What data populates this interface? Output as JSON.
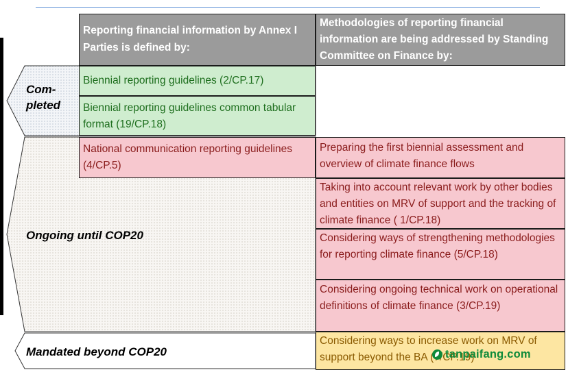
{
  "headers": {
    "left": "Reporting financial information by Annex I Parties is defined by:",
    "right": "Methodologies of reporting financial information are being addressed by  Standing Committee on Finance  by:"
  },
  "bands": {
    "completed_line1": "Com-",
    "completed_line2": "pleted",
    "ongoing": "Ongoing until COP20",
    "beyond": "Mandated beyond COP20"
  },
  "left_column": [
    "Biennial reporting guidelines (2/CP.17)",
    "Biennial reporting guidelines  common tabular format (19/CP.18)",
    "National communication reporting guidelines  (4/CP.5)"
  ],
  "right_column": [
    "Preparing the first biennial assessment and overview of climate finance flows",
    "Taking into account relevant work by other bodies and entities on MRV of support and the tracking of climate finance ( 1/CP.18)",
    "Considering ways of strengthening methodologies for reporting climate finance (5/CP.18)",
    "Considering ongoing technical work on operational definitions of climate finance (3/CP.19)",
    "Considering ways to increase work on MRV of support beyond the BA (7/CP.19)"
  ],
  "watermark": "tanpaifang.com",
  "colors": {
    "header": "#9b9b9b",
    "completed": "#cfedcf",
    "ongoing": "#f7c8cf",
    "beyond": "#fde6a2"
  }
}
